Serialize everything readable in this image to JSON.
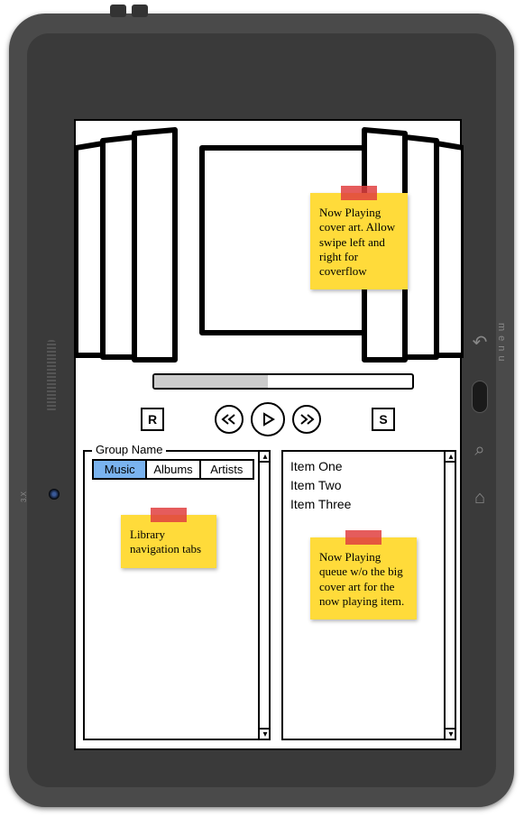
{
  "device": {
    "side_label": "menu",
    "manufacturer": "3.X"
  },
  "cover_note": "Now Playing cover art. Allow swipe left and right for coverflow",
  "progress": {
    "percent": 44
  },
  "controls": {
    "repeat": "R",
    "shuffle": "S"
  },
  "library": {
    "legend": "Group Name",
    "tabs": [
      {
        "label": "Music",
        "active": true
      },
      {
        "label": "Albums",
        "active": false
      },
      {
        "label": "Artists",
        "active": false
      }
    ],
    "note": "Library navigation tabs"
  },
  "queue": {
    "items": [
      "Item One",
      "Item Two",
      "Item Three"
    ],
    "note": "Now Playing queue w/o the big cover art for the now playing item."
  }
}
